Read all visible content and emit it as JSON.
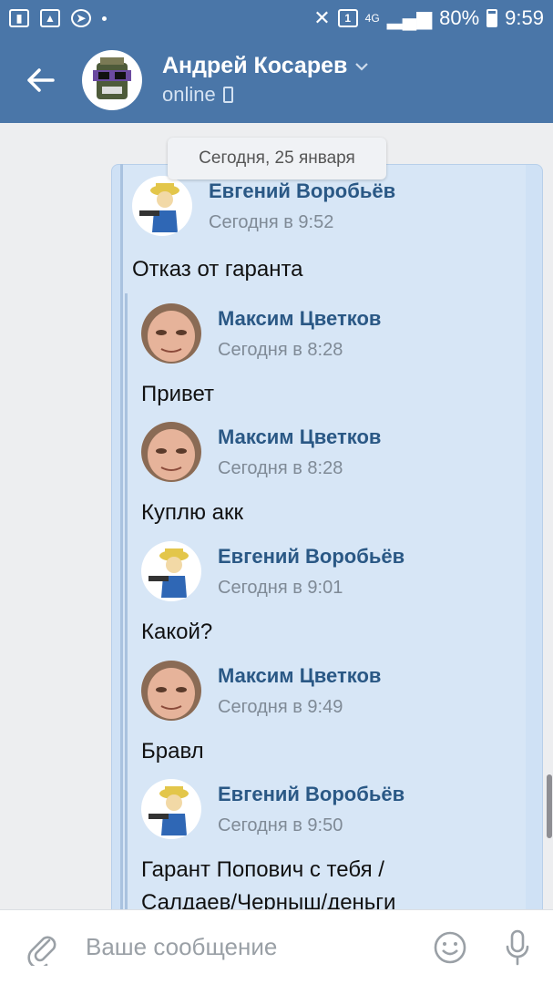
{
  "status_bar": {
    "network": "4G",
    "sim": "1",
    "battery": "80%",
    "time": "9:59"
  },
  "header": {
    "name": "Андрей Косарев",
    "status": "online"
  },
  "chat": {
    "date": "Сегодня, 25 января",
    "outer": {
      "sender": "Евгений Воробьёв",
      "time": "Сегодня в 9:52",
      "text": "Отказ от гаранта"
    },
    "forwarded": [
      {
        "sender": "Максим Цветков",
        "time": "Сегодня в 8:28",
        "text": "Привет"
      },
      {
        "sender": "Максим Цветков",
        "time": "Сегодня в 8:28",
        "text": "Куплю акк"
      },
      {
        "sender": "Евгений Воробьёв",
        "time": "Сегодня в 9:01",
        "text": "Какой?"
      },
      {
        "sender": "Максим Цветков",
        "time": "Сегодня в 9:49",
        "text": "Бравл"
      },
      {
        "sender": "Евгений Воробьёв",
        "time": "Сегодня в 9:50",
        "text_line1": "Гарант Попович с тебя /",
        "text_line2": "Салдаев/Черныш/деньги"
      }
    ]
  },
  "composer": {
    "placeholder": "Ваше сообщение"
  },
  "colors": {
    "header": "#4a76a8",
    "sender": "#2a5885",
    "bubble": "#d7e6f6"
  }
}
